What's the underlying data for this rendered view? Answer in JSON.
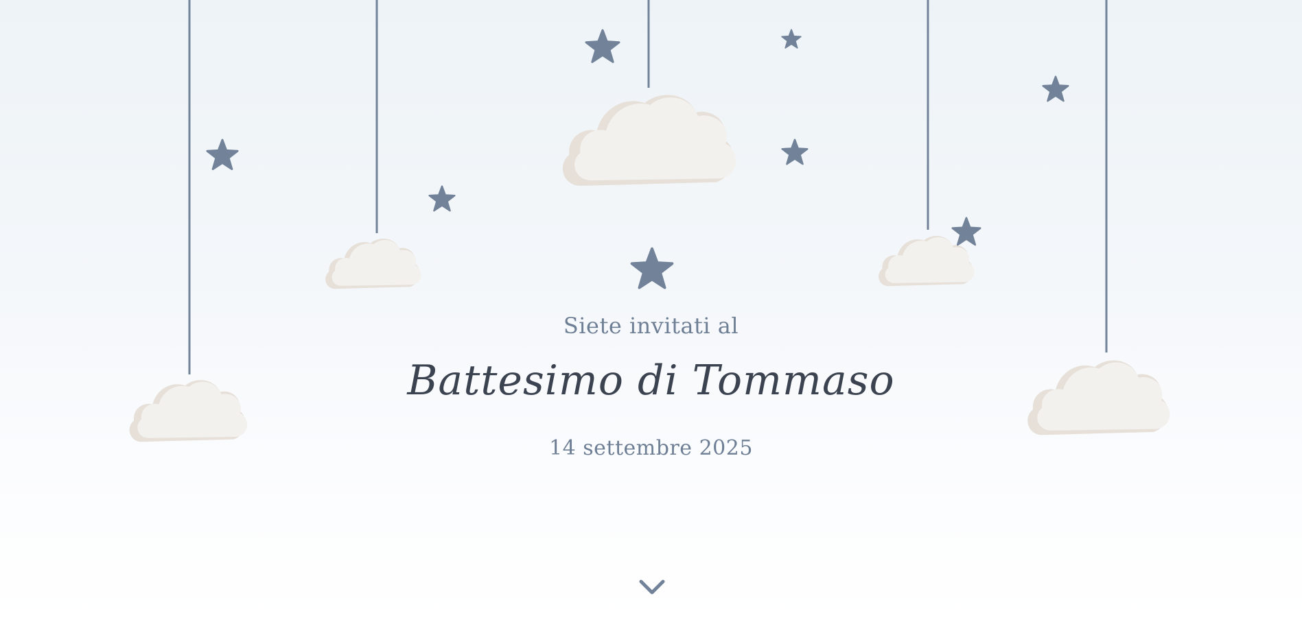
{
  "invitation": {
    "intro": "Siete invitati al",
    "title": "Battesimo di Tommaso",
    "date": "14 settembre 2025"
  },
  "decor": {
    "string_color": "#718299",
    "star_color": "#718299",
    "cloud_color": "#f3f1ee",
    "cloud_shadow_color": "#e6e0d9",
    "text_color": "#6e7f95",
    "title_color": "#3c4350"
  },
  "scroll_indicator": {
    "icon": "chevron-down-icon"
  }
}
